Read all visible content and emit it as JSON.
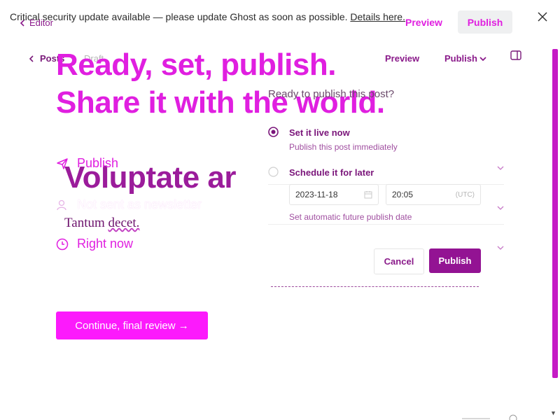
{
  "banner": {
    "text": "Critical security update available — please update Ghost as soon as possible.",
    "link": "Details here."
  },
  "topbar": {
    "back_label": "Editor",
    "preview_label": "Preview",
    "publish_label": "Publish"
  },
  "editor_header": {
    "posts_label": "Posts",
    "status_label": "Draft",
    "preview_label": "Preview",
    "publish_label": "Publish"
  },
  "headline": {
    "line1": "Ready, set, publish.",
    "line2": "Share it with the world."
  },
  "post": {
    "title": "Voluptate ar",
    "body_word1": "Tantum",
    "body_word2": "decet."
  },
  "summary": {
    "items": [
      {
        "label": "Publish",
        "icon": "send-icon"
      },
      {
        "label": "Not sent as newsletter",
        "icon": "users-icon"
      },
      {
        "label": "Right now",
        "icon": "clock-icon"
      }
    ],
    "continue_label": "Continue, final review →"
  },
  "panel": {
    "question": "Ready to publish this post?",
    "options": [
      {
        "label": "Set it live now",
        "sub": "Publish this post immediately",
        "selected": true
      },
      {
        "label": "Schedule it for later",
        "sub": "Set automatic future publish date",
        "selected": false
      }
    ],
    "date_value": "2023-11-18",
    "time_value": "20:05",
    "timezone": "(UTC)",
    "cancel_label": "Cancel",
    "publish_label": "Publish"
  },
  "colors": {
    "accent": "#e01fe0",
    "purple": "#931393",
    "continue_bg": "#fc1afc"
  }
}
